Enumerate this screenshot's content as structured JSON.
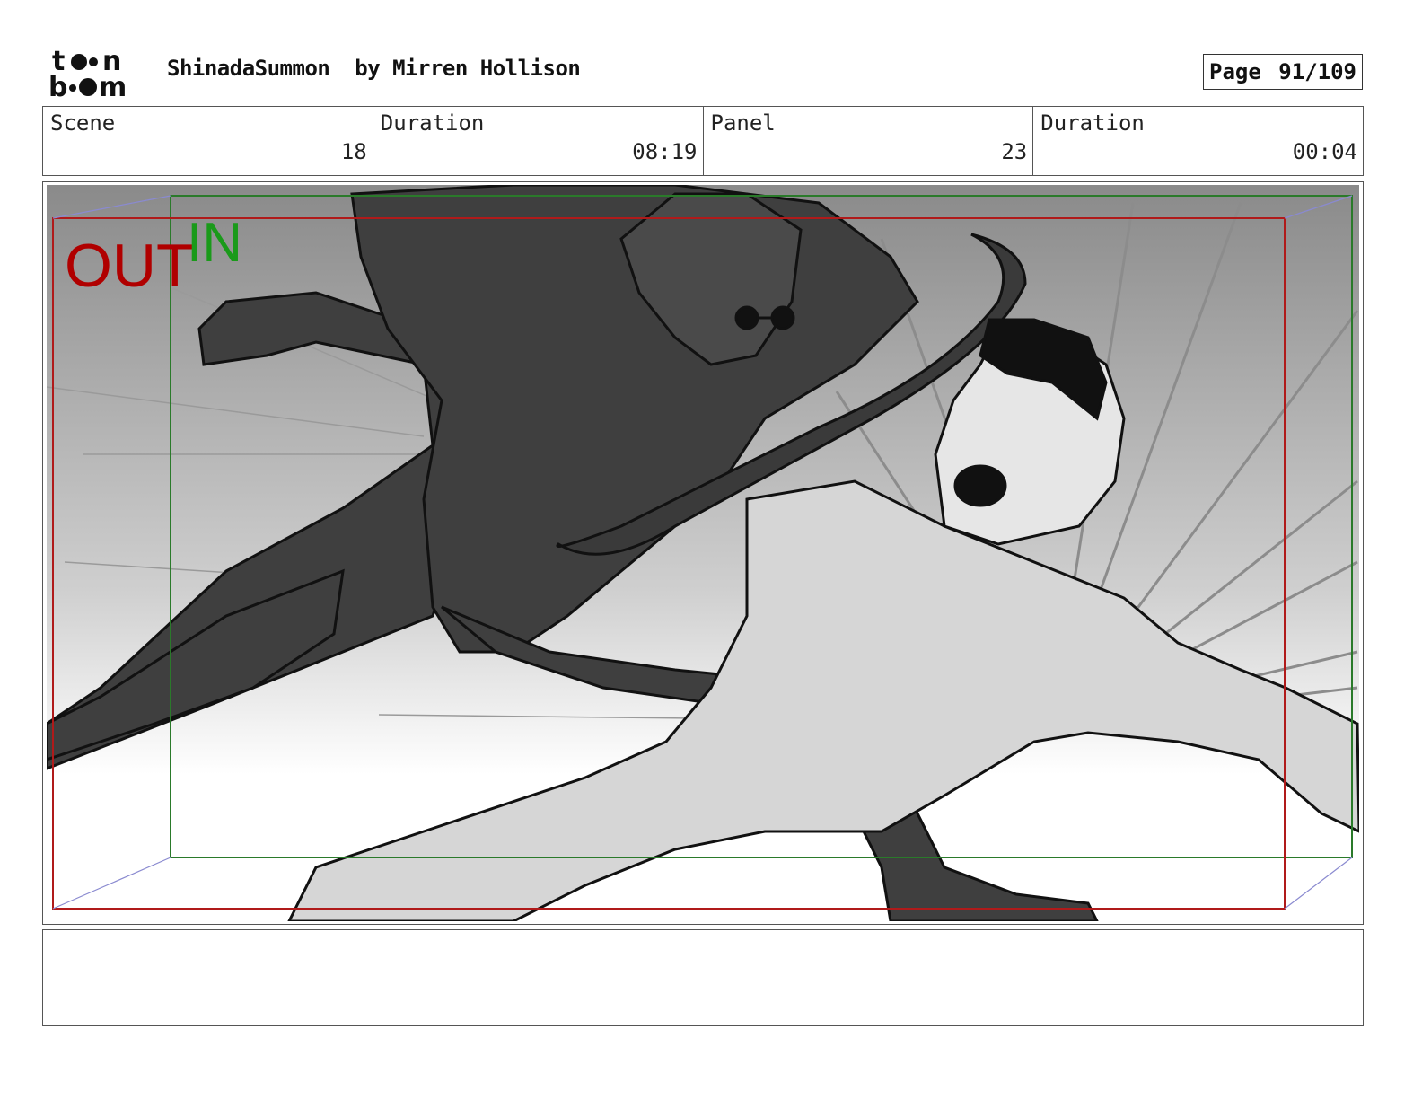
{
  "header": {
    "logo_text_top": "t●●n",
    "logo_text_bottom": "b●●m",
    "project": "ShinadaSummon",
    "author_prefix": "by",
    "author": "Mirren Hollison",
    "page_label": "Page",
    "page_value": "91/109"
  },
  "info": {
    "scene_label": "Scene",
    "scene_value": "18",
    "scene_duration_label": "Duration",
    "scene_duration_value": "08:19",
    "panel_label": "Panel",
    "panel_value": "23",
    "panel_duration_label": "Duration",
    "panel_duration_value": "00:04"
  },
  "panel": {
    "out_label": "OUT",
    "in_label": "IN",
    "out_color": "#b00000",
    "in_color": "#1a9a1a",
    "frame_out_color": "#b01a1a",
    "frame_in_color": "#2a7a2a"
  },
  "notes": {
    "text": ""
  }
}
